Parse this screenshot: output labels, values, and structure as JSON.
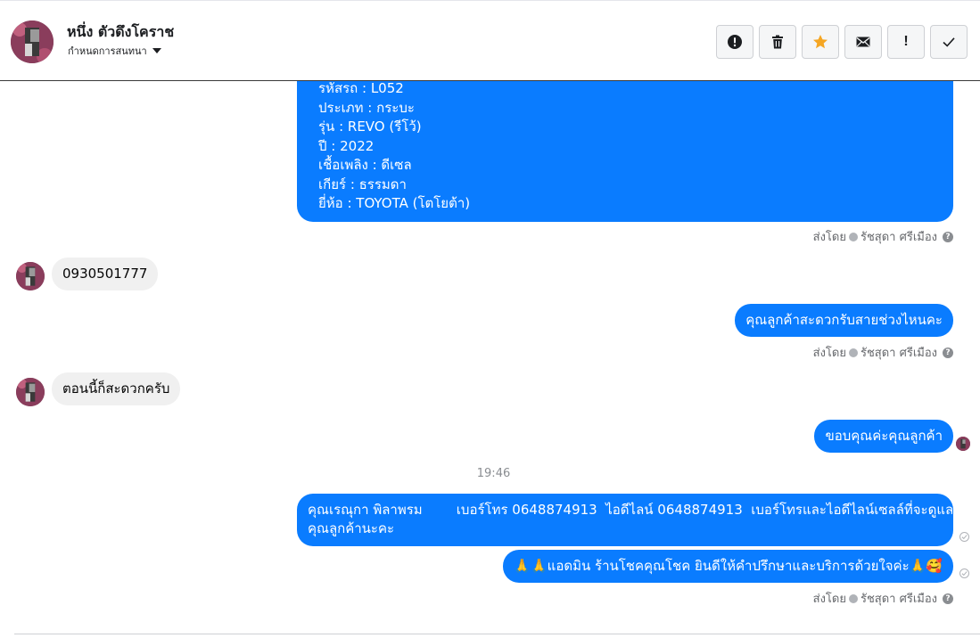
{
  "header": {
    "contact_name": "หนึ่ง ตัวดึงโคราช",
    "subtitle": "กำหนดการสนทนา",
    "actions": [
      {
        "name": "alert-icon",
        "label": "Report"
      },
      {
        "name": "trash-icon",
        "label": "Delete"
      },
      {
        "name": "star-icon",
        "label": "Star"
      },
      {
        "name": "envelope-icon",
        "label": "Mark unread"
      },
      {
        "name": "exclamation-icon",
        "label": "!"
      },
      {
        "name": "checkmark-icon",
        "label": "Done"
      }
    ]
  },
  "colors": {
    "outgoing_bubble": "#0a7cff",
    "incoming_bubble": "#f0f0f0",
    "star": "#f5a623"
  },
  "messages": {
    "car_info_lines": [
      "รหัสรถ : L052",
      "ประเภท : กระบะ",
      "รุ่น : REVO (รีโว้)",
      "ปี : 2022",
      "เชื้อเพลิง : ดีเซล",
      "เกียร์ : ธรรมดา",
      "ยี่ห้อ : TOYOTA (โตโยต้า)"
    ],
    "sent_by_1": "ส่งโดย",
    "sender_name_1": "รัชสุดา ศรีเมือง",
    "incoming_phone": "0930501777",
    "outgoing_ask": "คุณลูกค้าสะดวกรับสายช่วงไหนคะ",
    "sent_by_2": "ส่งโดย",
    "sender_name_2": "รัชสุดา ศรีเมือง",
    "incoming_now": "ตอนนี้ก็สะดวกครับ",
    "outgoing_thanks": "ขอบคุณค่ะคุณลูกค้า",
    "time_divider": "19:46",
    "outgoing_contact_line1": "คุณเรณุกา พิลาพรม        เบอร์โทร 0648874913  ไอดีไลน์ 0648874913  เบอร์โทรและไอดีไลน์เซลล์ที่จะดูแล",
    "outgoing_contact_line2": "คุณลูกค้านะคะ",
    "outgoing_admin": "🙏🙏แอดมิน ร้านโชคคุณโชค ยินดีให้คำปรึกษาและบริการด้วยใจค่ะ🙏🥰",
    "sent_by_3": "ส่งโดย",
    "sender_name_3": "รัชสุดา ศรีเมือง"
  }
}
